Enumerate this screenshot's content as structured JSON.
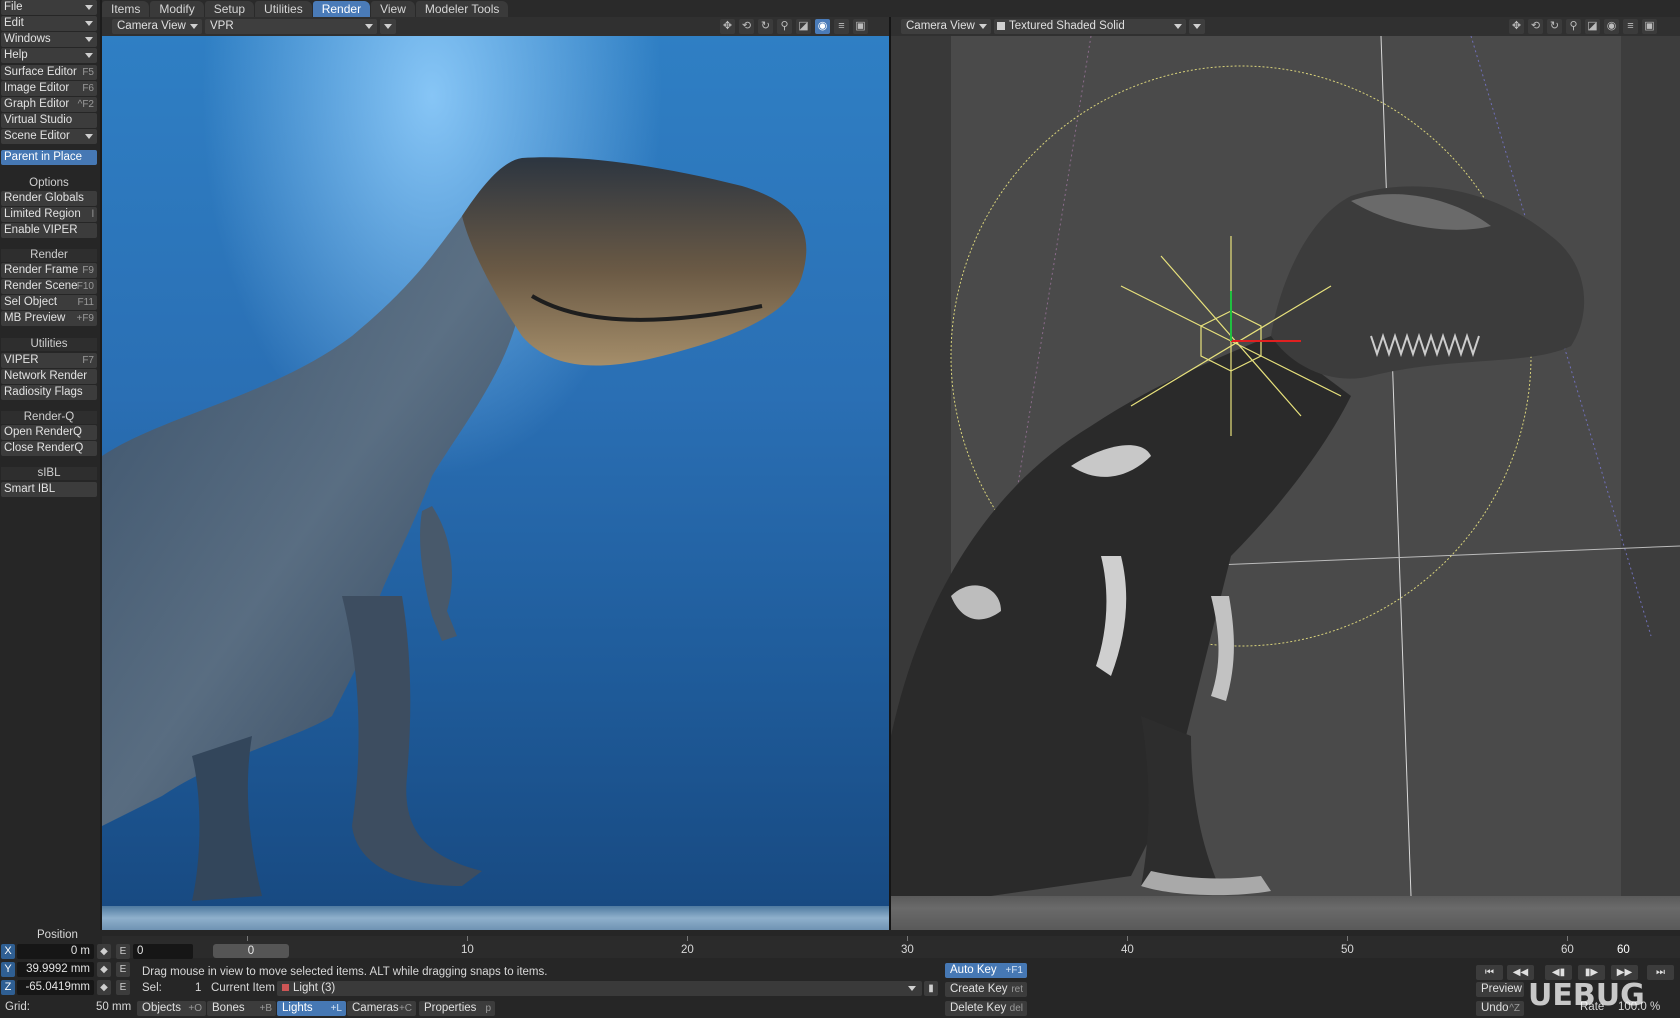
{
  "tabs": [
    "Items",
    "Modify",
    "Setup",
    "Utilities",
    "Render",
    "View",
    "Modeler Tools"
  ],
  "active_tab": "Render",
  "toolbar": {
    "menus": [
      {
        "label": "File"
      },
      {
        "label": "Edit"
      },
      {
        "label": "Windows"
      },
      {
        "label": "Help"
      }
    ],
    "items_top": [
      {
        "label": "Surface Editor",
        "shortcut": "F5"
      },
      {
        "label": "Image Editor",
        "shortcut": "F6"
      },
      {
        "label": "Graph Editor",
        "shortcut": "^F2"
      },
      {
        "label": "Virtual Studio",
        "shortcut": ""
      },
      {
        "label": "Scene Editor",
        "shortcut": ""
      }
    ],
    "parent_in_place": "Parent in Place",
    "options_header": "Options",
    "options": [
      {
        "label": "Render Globals",
        "shortcut": ""
      },
      {
        "label": "Limited Region",
        "shortcut": "l"
      },
      {
        "label": "Enable VIPER",
        "shortcut": ""
      }
    ],
    "render_header": "Render",
    "render": [
      {
        "label": "Render Frame",
        "shortcut": "F9"
      },
      {
        "label": "Render Scene",
        "shortcut": "F10"
      },
      {
        "label": "Sel Object",
        "shortcut": "F11"
      },
      {
        "label": "MB Preview",
        "shortcut": "+F9"
      }
    ],
    "utilities_header": "Utilities",
    "utilities": [
      {
        "label": "VIPER",
        "shortcut": "F7"
      },
      {
        "label": "Network Render",
        "shortcut": ""
      },
      {
        "label": "Radiosity Flags",
        "shortcut": ""
      }
    ],
    "renderq_header": "Render-Q",
    "renderq": [
      {
        "label": "Open RenderQ",
        "shortcut": ""
      },
      {
        "label": "Close RenderQ",
        "shortcut": ""
      }
    ],
    "sibl_header": "sIBL",
    "sibl": [
      {
        "label": "Smart IBL",
        "shortcut": ""
      }
    ]
  },
  "viewport_left": {
    "view": "Camera View",
    "mode": "VPR"
  },
  "viewport_right": {
    "view": "Camera View",
    "mode": "Textured Shaded Solid"
  },
  "timeline": {
    "ticks": [
      "0",
      "10",
      "20",
      "30",
      "40",
      "50",
      "60"
    ],
    "current_frame": "0",
    "end_frame": "60"
  },
  "position": {
    "label": "Position",
    "x": {
      "axis": "X",
      "value": "0 m"
    },
    "y": {
      "axis": "Y",
      "value": "39.9992 mm"
    },
    "z": {
      "axis": "Z",
      "value": "-65.0419mm"
    },
    "e": "E",
    "frame_field": "0"
  },
  "grid": {
    "label": "Grid:",
    "value": "50 mm"
  },
  "status": "Drag mouse in view to move selected items. ALT while dragging snaps to items.",
  "sel": {
    "label": "Sel:",
    "value": "1"
  },
  "current_item": {
    "label": "Current Item",
    "value": "Light (3)"
  },
  "item_types": [
    {
      "label": "Objects",
      "shortcut": "+O"
    },
    {
      "label": "Bones",
      "shortcut": "+B"
    },
    {
      "label": "Lights",
      "shortcut": "+L"
    },
    {
      "label": "Cameras",
      "shortcut": "+C"
    },
    {
      "label": "Properties",
      "shortcut": "p"
    }
  ],
  "keys": {
    "auto_key": "Auto Key",
    "auto_key_sc": "+F1",
    "create_key": "Create Key",
    "create_key_sc": "ret",
    "delete_key": "Delete Key",
    "delete_key_sc": "del"
  },
  "playback": {
    "preview": "Preview",
    "undo": "Undo",
    "undo_sc": "^Z",
    "rate": "Rate",
    "rate_value": "100.0 %"
  },
  "watermark": "UEBUG",
  "colors": {
    "accent": "#4a7bb8",
    "panel": "#262626",
    "button": "#3c3c3c"
  }
}
